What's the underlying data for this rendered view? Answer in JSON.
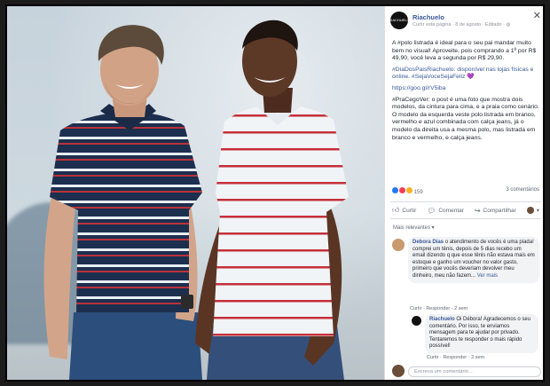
{
  "post": {
    "page_name": "Riachuelo",
    "logo_text": "RIACHUELO",
    "meta": "Curtir esta página · 8 de agosto · Editado · ",
    "paragraph1": "A #polo listrada é ideal para o seu pai mandar muito bem no visual! Aproveite, pois comprando a 1ª por R$ 49,90, você leva a segunda por R$ 29,90.",
    "hashtags": "#DiaDosPaisRiachuelo: disponível nas lojas físicas e online. #SejaVoceSejaFeliz 💜",
    "link": "https://goo.gl/rV5iba",
    "paragraph2": "#PraCegoVer: o post é uma foto que mostra dois modelos, da cintura para cima, e a praia como cenário. O modelo da esquerda veste polo listrada em branco, vermelho e azul combinada com calça jeans, já o modelo da direita usa a mesma polo, mas listrada em branco e vermelho, e calça jeans."
  },
  "reactions": {
    "count": "159",
    "comments": "3 comentários"
  },
  "actions": {
    "like": "Curtir",
    "comment": "Comentar",
    "share": "Compartilhar"
  },
  "relevant_label": "Mais relevantes ▾",
  "comments": [
    {
      "name": "Debora Dias",
      "text": "o atendimento de vocês é uma piada! comprei um tênis, depois de 5 dias recebo um email dizendo q que esse tênis não estava mais em estoque e ganho um voucher no valor gasto, primeiro que vocês deveriam devolver meu dinheiro, meu não fazem...",
      "more": "Ver mais",
      "meta": "Curtir · Responder · 2 sem"
    },
    {
      "name": "Riachuelo",
      "reply_to": "Oi Débora!",
      "text": "Agradecemos o seu comentário. Por isso, te enviamos mensagem para te ajudar por privado. Tentaremos te responder o mais rápido possível!",
      "meta": "Curtir · Responder · 2 sem"
    }
  ],
  "write_placeholder": "Escreva um comentário...",
  "colors": {
    "link": "#385898",
    "bubble": "#f2f3f5",
    "stripe_red": "#c4303a",
    "polo_navy": "#1d2f4f"
  },
  "icons": [
    "close-icon",
    "globe-icon",
    "like-icon",
    "comment-icon",
    "share-icon",
    "love-reaction-icon"
  ]
}
